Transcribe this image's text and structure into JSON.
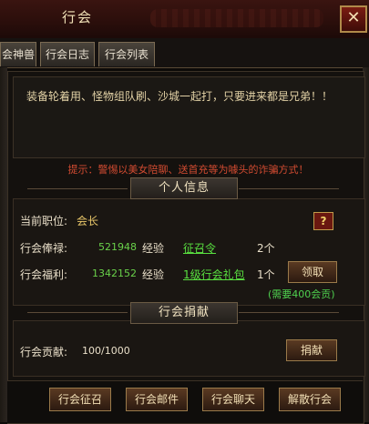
{
  "window": {
    "title": "行会",
    "close_glyph": "✕"
  },
  "tabs": [
    {
      "label": "会神兽"
    },
    {
      "label": "行会日志"
    },
    {
      "label": "行会列表"
    }
  ],
  "notice": {
    "text": "装备轮着用、怪物组队刷、沙城一起打，只要进来都是兄弟！！"
  },
  "warning": "提示：警惕以美女陪聊、送首充等为噱头的诈骗方式！",
  "personal": {
    "header": "个人信息",
    "position_label": "当前职位:",
    "position_value": "会长",
    "help_glyph": "?",
    "salary_label": "行会俸禄:",
    "salary_exp": "521948",
    "salary_exp_label": "经验",
    "salary_item": "征召令",
    "salary_count": "2个",
    "welfare_label": "行会福利:",
    "welfare_exp": "1342152",
    "welfare_exp_label": "经验",
    "welfare_item": "1级行会礼包",
    "welfare_count": "1个",
    "claim_button": "领取",
    "claim_note": "(需要400会贡)"
  },
  "donation": {
    "header": "行会捐献",
    "contribution_label": "行会贡献:",
    "contribution_value": "100/1000",
    "donate_button": "捐献"
  },
  "bottom_buttons": {
    "recruit": "行会征召",
    "mail": "行会邮件",
    "chat": "行会聊天",
    "disband": "解散行会"
  }
}
